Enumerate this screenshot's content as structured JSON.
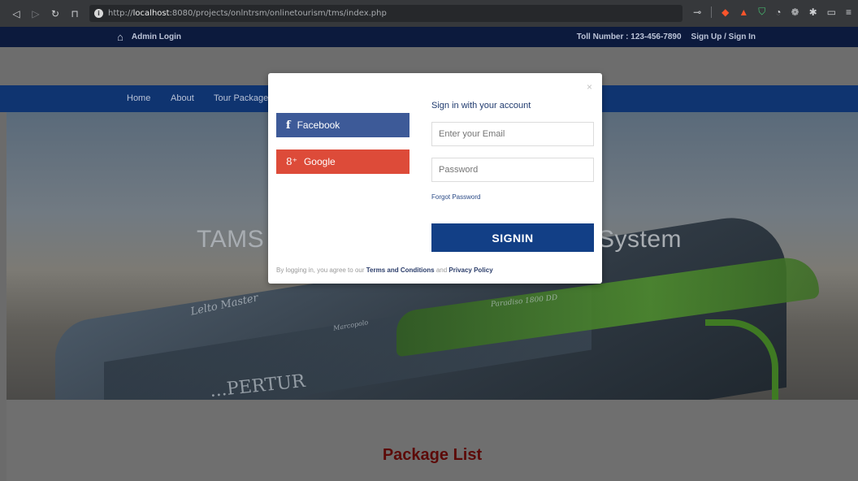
{
  "browser": {
    "back_icon": "back-icon",
    "url_protocol": "http://",
    "url_host": "localhost",
    "url_rest": ":8080/projects/onlntrsm/onlinetourism/tms/index.php"
  },
  "topbar": {
    "admin_login": "Admin Login",
    "toll_number": "Toll Number : 123-456-7890",
    "signup_signin": "Sign Up / Sign In"
  },
  "nav": {
    "items": [
      "Home",
      "About",
      "Tour Package"
    ]
  },
  "banner": {
    "title_left": "TAMS",
    "title_right": "System",
    "bus_text_1": "Lelto Master",
    "bus_text_2": "Marcopolo",
    "bus_text_3": "Paradiso 1800 DD",
    "bus_text_4": "...PERTUR"
  },
  "content": {
    "package_heading": "Package List"
  },
  "modal": {
    "close": "×",
    "facebook_label": "Facebook",
    "google_label": "Google",
    "signin_title": "Sign in with your account",
    "email_placeholder": "Enter your Email",
    "password_placeholder": "Password",
    "forgot_password": "Forgot Password",
    "signin_button": "SIGNIN",
    "terms_prefix": "By logging in, you agree to our ",
    "terms_link": "Terms and Conditions",
    "terms_and": " and ",
    "privacy_link": "Privacy Policy"
  },
  "colors": {
    "topbar": "#0c1a3d",
    "nav": "#0f3470",
    "facebook": "#3d5a98",
    "google": "#dd4b39",
    "signin": "#123f86",
    "heading": "#5c0a08"
  }
}
